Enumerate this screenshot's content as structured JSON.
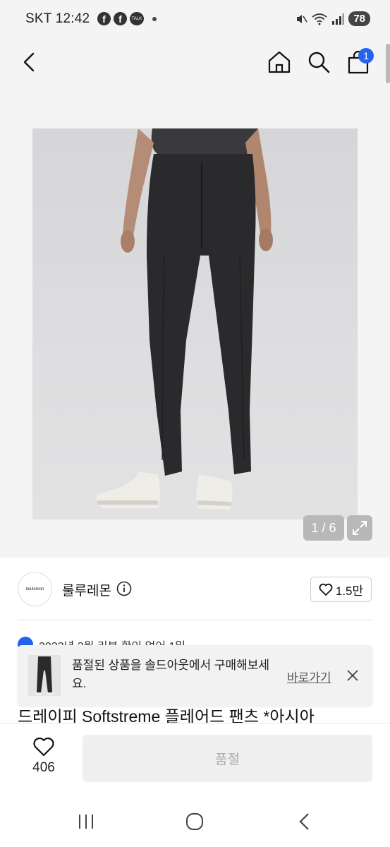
{
  "status_bar": {
    "carrier": "SKT",
    "time": "12:42",
    "talk_label": "TALK",
    "battery": "78",
    "icons": [
      "facebook-icon",
      "facebook-icon",
      "kakaotalk-icon",
      "mute-icon",
      "wifi-icon",
      "signal-icon"
    ]
  },
  "nav": {
    "back_icon": "back-arrow-icon",
    "home_icon": "home-icon",
    "search_icon": "search-icon",
    "cart_icon": "shopping-bag-icon",
    "cart_count": "1"
  },
  "gallery": {
    "pager": "1 / 6",
    "expand_icon": "expand-icon"
  },
  "seller": {
    "logo_text": "lululemon",
    "name": "룰루레몬",
    "like_count": "1.5만"
  },
  "notice": {
    "peek_text": "2023년 3월 리뷰 확인 없어 1일 ›"
  },
  "toast": {
    "message": "품절된 상품을 솔드아웃에서 구매해보세요.",
    "link_label": "바로가기",
    "close_icon": "close-icon"
  },
  "product": {
    "title": "드레이피 Softstreme 플레어드 팬츠 *아시아"
  },
  "bottom_bar": {
    "wishlist_count": "406",
    "buy_label": "품절"
  },
  "system_nav": {
    "recents_icon": "recents-icon",
    "home_icon": "home-circle-icon",
    "back_icon": "back-chevron-icon"
  },
  "colors": {
    "accent": "#2463f0",
    "page_bg": "#f4f4f4",
    "disabled_button": "#efefef"
  }
}
